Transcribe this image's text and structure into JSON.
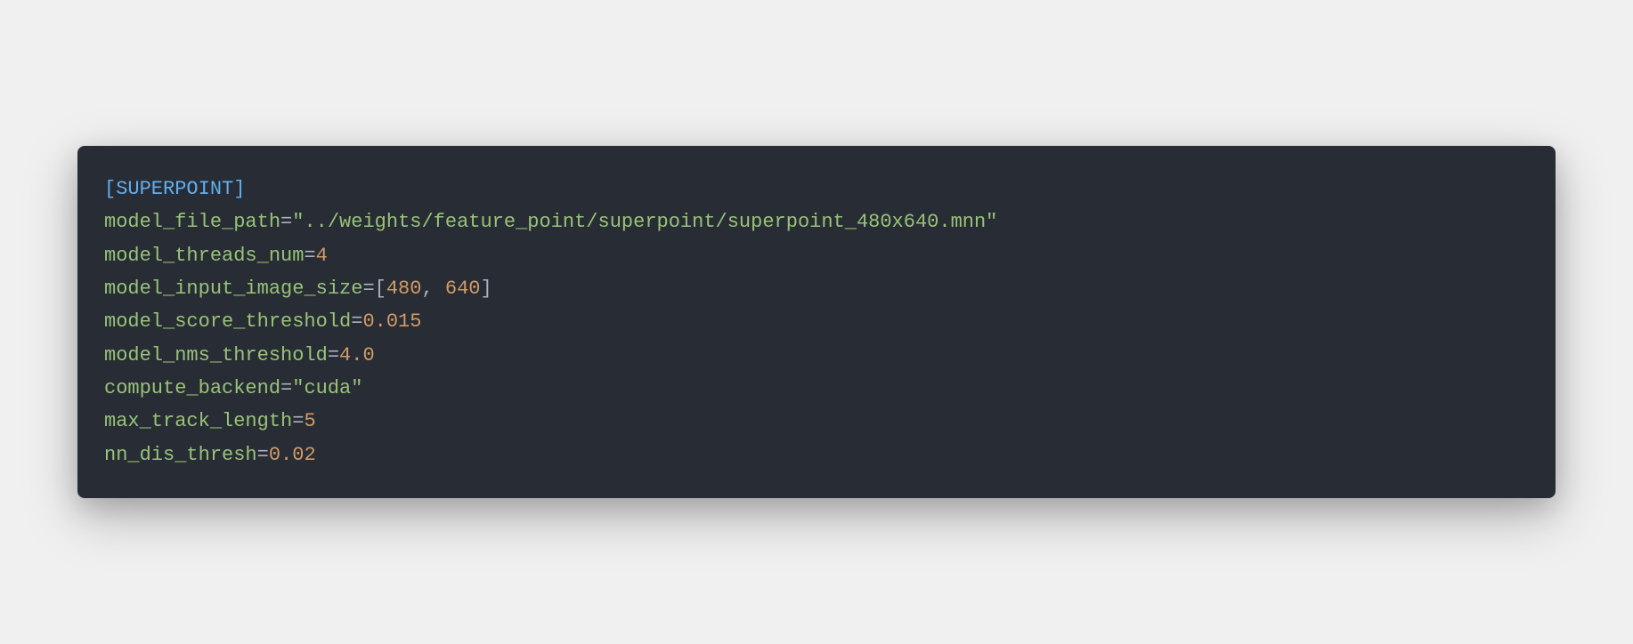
{
  "section_header": "[SUPERPOINT]",
  "lines": [
    {
      "key": "model_file_path",
      "value": "\"../weights/feature_point/superpoint/superpoint_480x640.mnn\"",
      "type": "string"
    },
    {
      "key": "model_threads_num",
      "value": "4",
      "type": "number"
    },
    {
      "key": "model_input_image_size",
      "value": "[480, 640]",
      "type": "array"
    },
    {
      "key": "model_score_threshold",
      "value": "0.015",
      "type": "number"
    },
    {
      "key": "model_nms_threshold",
      "value": "4.0",
      "type": "number"
    },
    {
      "key": "compute_backend",
      "value": "\"cuda\"",
      "type": "string"
    },
    {
      "key": "max_track_length",
      "value": "5",
      "type": "number"
    },
    {
      "key": "nn_dis_thresh",
      "value": "0.02",
      "type": "number"
    }
  ],
  "array_open": "[",
  "array_close": "]",
  "array_sep": ", ",
  "array_items": [
    "480",
    "640"
  ]
}
